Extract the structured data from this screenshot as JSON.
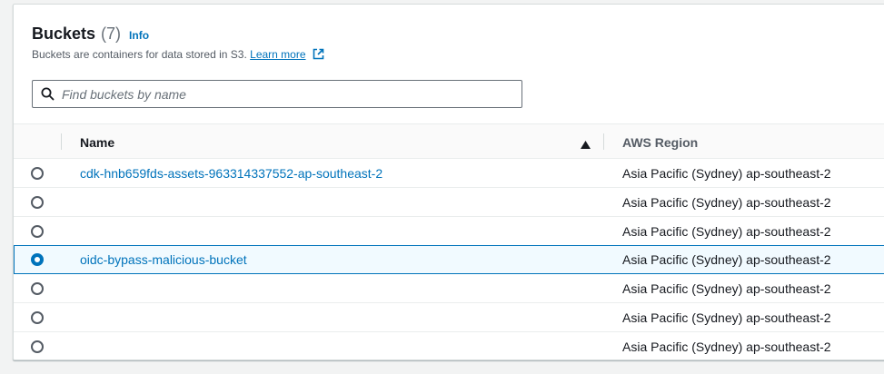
{
  "section": {
    "title": "Buckets",
    "count": "(7)",
    "info_label": "Info",
    "description": "Buckets are containers for data stored in S3.",
    "learn_more": "Learn more"
  },
  "search": {
    "placeholder": "Find buckets by name",
    "value": ""
  },
  "table": {
    "columns": {
      "name": "Name",
      "region": "AWS Region"
    },
    "sort_icon": "sort-ascending-icon",
    "rows": [
      {
        "name": "cdk-hnb659fds-assets-963314337552-ap-southeast-2",
        "region": "Asia Pacific (Sydney) ap-southeast-2",
        "selected": false
      },
      {
        "name": "",
        "region": "Asia Pacific (Sydney) ap-southeast-2",
        "selected": false
      },
      {
        "name": "",
        "region": "Asia Pacific (Sydney) ap-southeast-2",
        "selected": false
      },
      {
        "name": "oidc-bypass-malicious-bucket",
        "region": "Asia Pacific (Sydney) ap-southeast-2",
        "selected": true
      },
      {
        "name": "",
        "region": "Asia Pacific (Sydney) ap-southeast-2",
        "selected": false
      },
      {
        "name": "",
        "region": "Asia Pacific (Sydney) ap-southeast-2",
        "selected": false
      },
      {
        "name": "",
        "region": "Asia Pacific (Sydney) ap-southeast-2",
        "selected": false
      }
    ]
  },
  "colors": {
    "link": "#0073bb",
    "selected_bg": "#f1faff",
    "selected_border": "#0073bb"
  }
}
